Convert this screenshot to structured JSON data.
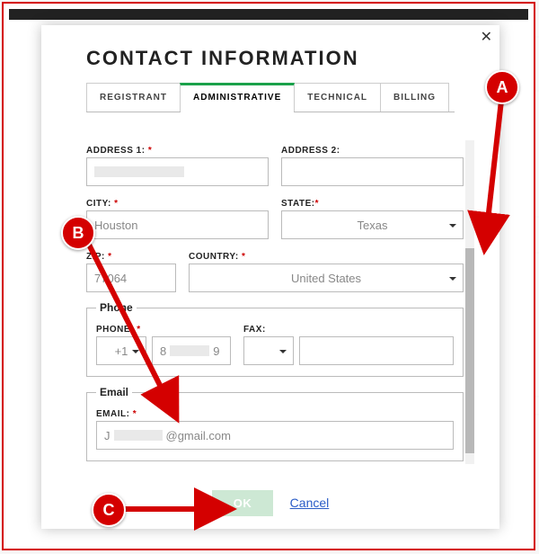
{
  "modal": {
    "title": "CONTACT INFORMATION",
    "close_glyph": "✕"
  },
  "tabs": [
    {
      "label": "REGISTRANT",
      "active": false
    },
    {
      "label": "ADMINISTRATIVE",
      "active": true
    },
    {
      "label": "TECHNICAL",
      "active": false
    },
    {
      "label": "BILLING",
      "active": false
    }
  ],
  "form": {
    "address1": {
      "label": "ADDRESS 1:",
      "required": true,
      "value": ""
    },
    "address2": {
      "label": "ADDRESS 2:",
      "required": false,
      "value": ""
    },
    "city": {
      "label": "CITY:",
      "required": true,
      "value": "Houston"
    },
    "state": {
      "label": "STATE:",
      "required": true,
      "value": "Texas"
    },
    "zip": {
      "label": "ZIP:",
      "required": true,
      "value": "77064"
    },
    "country": {
      "label": "COUNTRY:",
      "required": true,
      "value": "United States"
    },
    "phone_section": {
      "legend": "Phone"
    },
    "phone_label": {
      "label": "PHONE:",
      "required": true
    },
    "phone_cc": {
      "value": "+1"
    },
    "phone_num": {
      "value_prefix": "8",
      "value_suffix": "9"
    },
    "fax": {
      "label": "FAX:",
      "value": ""
    },
    "email_section": {
      "legend": "Email"
    },
    "email": {
      "label": "EMAIL:",
      "required": true,
      "value_prefix": "J",
      "value_suffix": "@gmail.com"
    }
  },
  "footer": {
    "ok": "OK",
    "cancel": "Cancel"
  },
  "annotations": {
    "A": "A",
    "B": "B",
    "C": "C"
  },
  "required_mark": "*"
}
